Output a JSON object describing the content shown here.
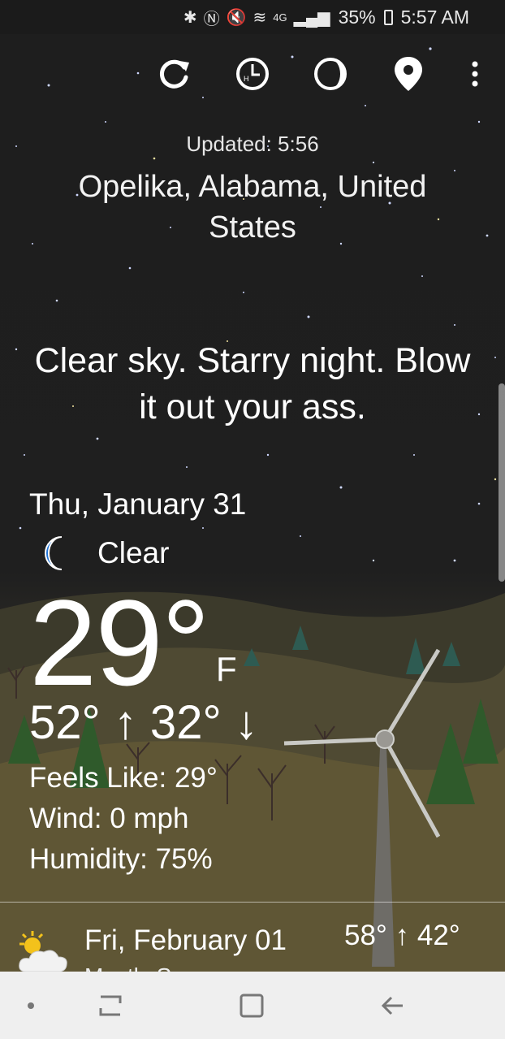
{
  "status_bar": {
    "icons": [
      "bluetooth-icon",
      "nfc-icon",
      "mute-icon",
      "wifi-icon",
      "4g-icon",
      "signal-icon"
    ],
    "battery": "35%",
    "time": "5:57 AM"
  },
  "toolbar": {
    "icons": [
      "refresh-icon",
      "hourly-history-icon",
      "moon-phase-icon",
      "location-pin-icon",
      "overflow-menu-icon"
    ]
  },
  "header": {
    "updated": "Updated: 5:56",
    "location": "Opelika, Alabama, United States"
  },
  "tagline": "Clear sky. Starry night. Blow it out your ass.",
  "current": {
    "date": "Thu, January 31",
    "condition": "Clear",
    "condition_icon": "moon-icon",
    "temperature": "29°",
    "unit": "F",
    "high_low": "52° ↑ 32° ↓",
    "feels_like": "Feels Like: 29°",
    "wind": "Wind: 0 mph",
    "humidity": "Humidity: 75%"
  },
  "forecast": [
    {
      "date": "Fri, February 01",
      "temps": "58° ↑ 42°",
      "subtitle": "Mostly Sunny",
      "icon": "partly-sunny-icon"
    }
  ],
  "navbar": {
    "icons": [
      "nav-dot-icon",
      "recents-icon",
      "home-icon",
      "back-icon"
    ]
  },
  "colors": {
    "sky": "#1e1e1e",
    "moon_icon": "#1e73d8",
    "hills": "#5e5532",
    "navbar": "#efefef"
  }
}
